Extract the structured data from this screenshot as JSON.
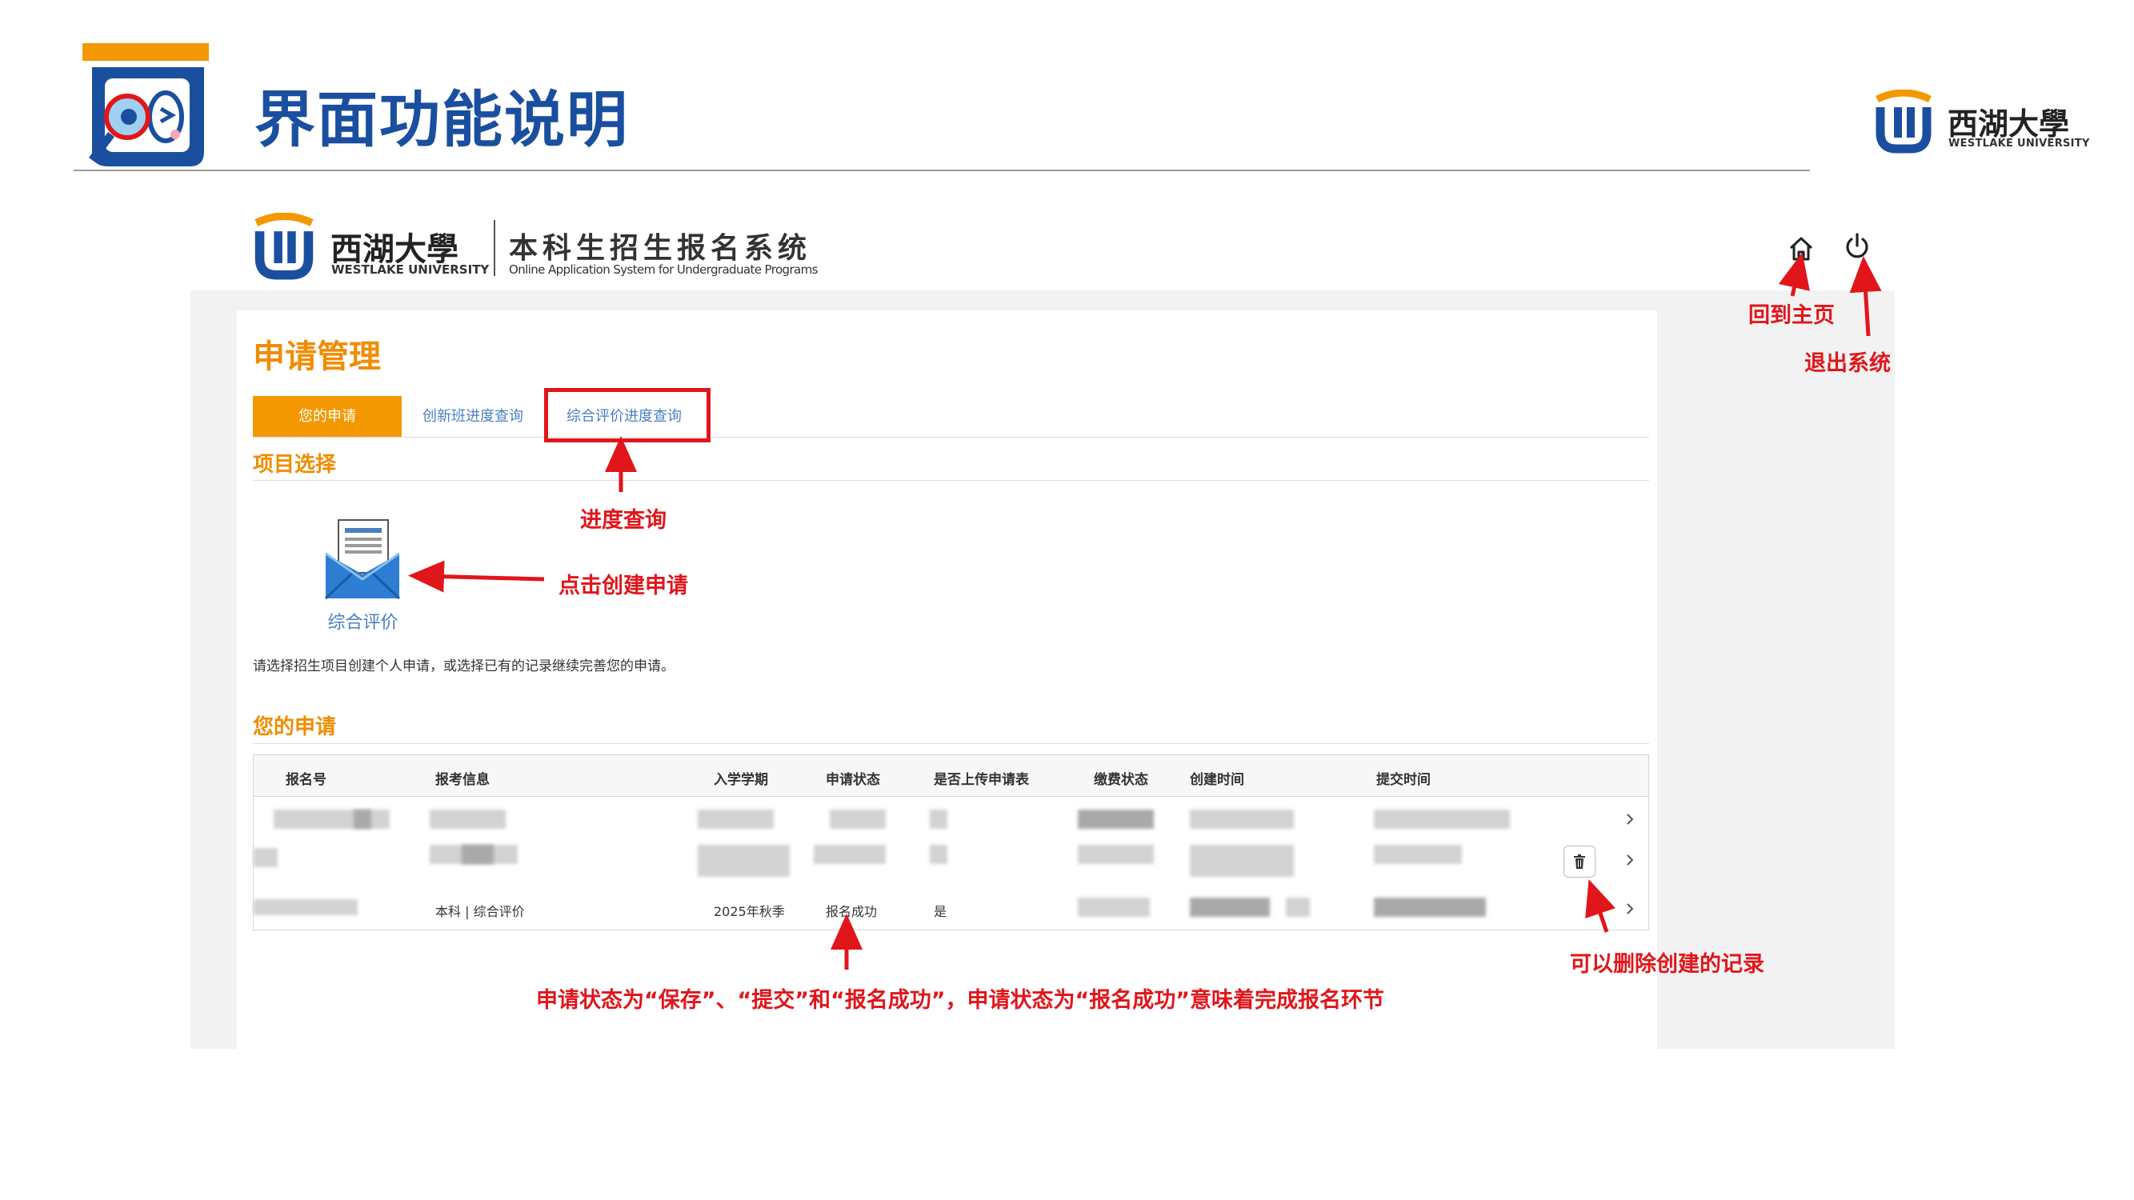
{
  "slide": {
    "title": "界面功能说明",
    "corner_brand": {
      "cn": "西湖大學",
      "en": "WESTLAKE UNIVERSITY"
    }
  },
  "system_header": {
    "university_cn": "西湖大學",
    "university_en": "WESTLAKE UNIVERSITY",
    "system_name": "本科生招生报名系统",
    "system_name_en": "Online Application System for Undergraduate Programs"
  },
  "page": {
    "heading": "申请管理",
    "tabs": [
      {
        "label": "您的申请",
        "active": true
      },
      {
        "label": "创新班进度查询",
        "active": false
      },
      {
        "label": "综合评价进度查询",
        "active": false
      }
    ],
    "project_section_title": "项目选择",
    "project_card_label": "综合评价",
    "hint": "请选择招生项目创建个人申请，或选择已有的记录继续完善您的申请。",
    "applications_section_title": "您的申请"
  },
  "table": {
    "columns": [
      "报名号",
      "报考信息",
      "入学学期",
      "申请状态",
      "是否上传申请表",
      "缴费状态",
      "创建时间",
      "提交时间"
    ],
    "visible_row": {
      "报考信息": "本科 | 综合评价",
      "入学学期": "2025年秋季",
      "申请状态": "报名成功",
      "是否上传申请表": "是"
    }
  },
  "annotations": {
    "home": "回到主页",
    "logout": "退出系统",
    "progress": "进度查询",
    "create": "点击创建申请",
    "delete": "可以删除创建的记录",
    "status": "申请状态为“保存”、“提交”和“报名成功”，申请状态为“报名成功”意味着完成报名环节"
  },
  "colors": {
    "title_blue": "#1a4fa0",
    "orange_accent": "#f39800",
    "link_blue": "#4a7fc1",
    "annotation_red": "#e0161b"
  },
  "icons": [
    "magnifier-mascot-icon",
    "westlake-logo-icon",
    "home-icon",
    "power-icon",
    "envelope-form-icon",
    "trash-icon",
    "chevron-right-icon"
  ]
}
